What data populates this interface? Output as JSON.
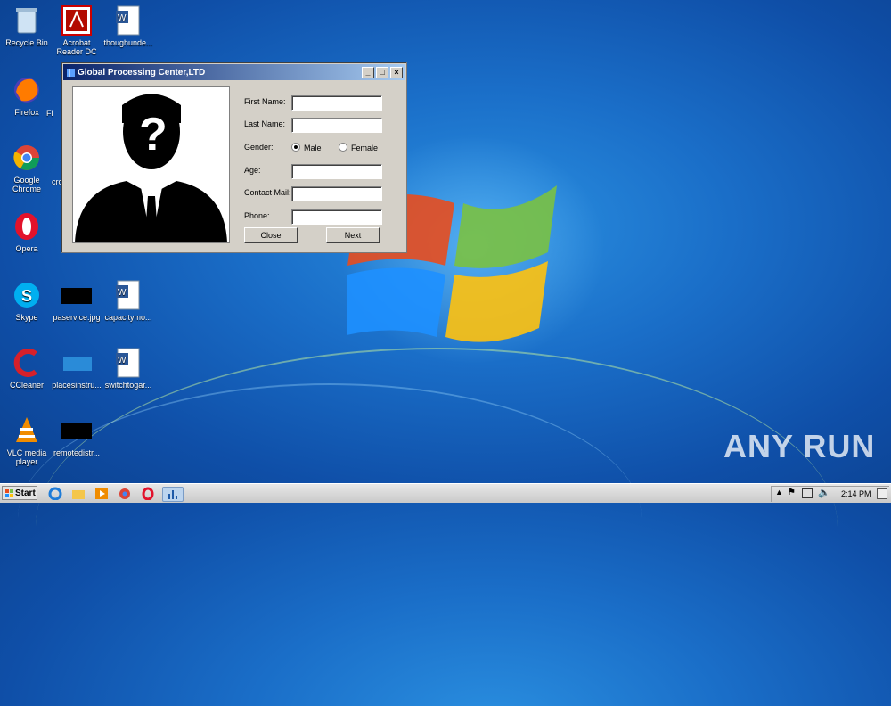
{
  "desktop": {
    "icons": [
      {
        "label": "Recycle Bin"
      },
      {
        "label": "Acrobat Reader DC"
      },
      {
        "label": "thoughunde..."
      },
      {
        "label": "Firefox"
      },
      {
        "label": "Fi"
      },
      {
        "label": "Google Chrome"
      },
      {
        "label": "cro"
      },
      {
        "label": "Opera"
      },
      {
        "label": "Skype"
      },
      {
        "label": "paservice.jpg"
      },
      {
        "label": "capacitymo..."
      },
      {
        "label": "CCleaner"
      },
      {
        "label": "placesinstru..."
      },
      {
        "label": "switchtogar..."
      },
      {
        "label": "VLC media player"
      },
      {
        "label": "remotedistr..."
      }
    ]
  },
  "window": {
    "title": "Global Processing Center,LTD",
    "buttons": {
      "minimize": "_",
      "maximize": "□",
      "close": "×"
    },
    "form": {
      "first_name_label": "First Name:",
      "last_name_label": "Last Name:",
      "gender_label": "Gender:",
      "male_label": "Male",
      "female_label": "Female",
      "age_label": "Age:",
      "contact_label": "Contact Mail:",
      "phone_label": "Phone:",
      "first_name_value": "",
      "last_name_value": "",
      "age_value": "",
      "contact_value": "",
      "phone_value": "",
      "selected_gender": "Male"
    },
    "close_label": "Close",
    "next_label": "Next"
  },
  "taskbar": {
    "start_label": "Start",
    "clock": "2:14 PM"
  },
  "watermark": "ANY RUN",
  "colors": {
    "titlebar_start": "#0a246a",
    "titlebar_end": "#a6caf0",
    "desktop": "#1a6ec8"
  }
}
